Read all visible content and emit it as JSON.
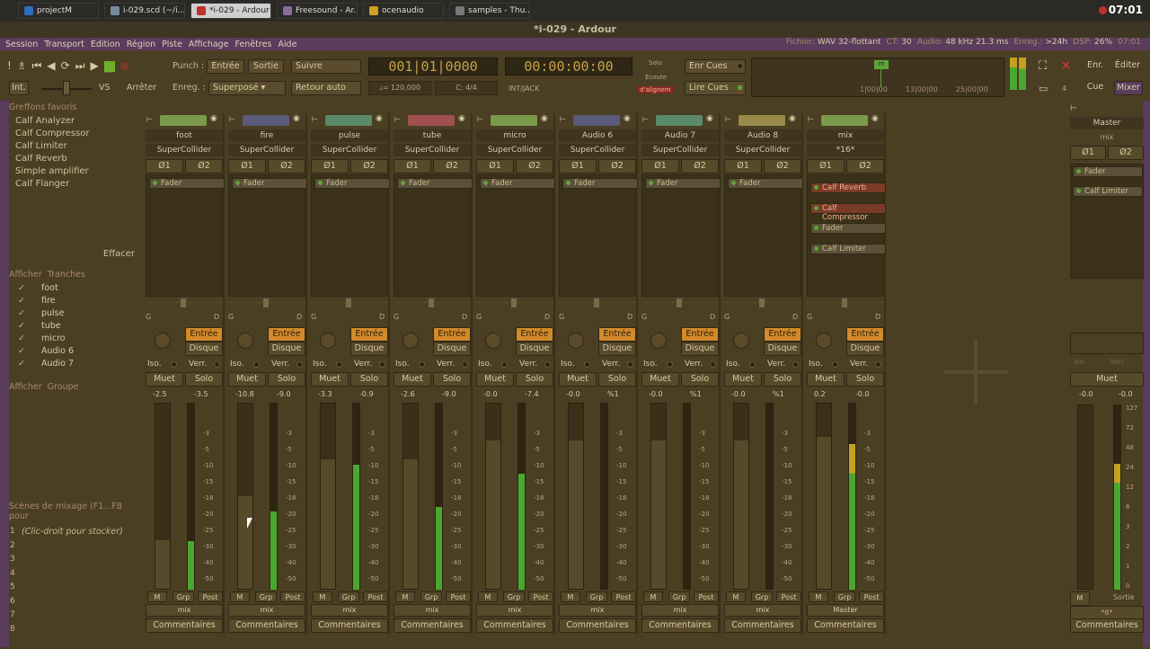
{
  "taskbar": {
    "items": [
      {
        "label": "projectM",
        "color": "#2b6fbf"
      },
      {
        "label": "i-029.scd (~/i...",
        "color": "#7a8aa0"
      },
      {
        "label": "*i-029 - Ardour",
        "color": "#c0302d"
      },
      {
        "label": "Freesound - Ar...",
        "color": "#8a6aa0"
      },
      {
        "label": "ocenaudio",
        "color": "#d0a020"
      },
      {
        "label": "samples - Thu...",
        "color": "#777777"
      }
    ],
    "clock": "07:01"
  },
  "window": {
    "title": "*i-029 - Ardour"
  },
  "menu": {
    "items": [
      "Session",
      "Transport",
      "Edition",
      "Région",
      "Piste",
      "Affichage",
      "Fenêtres",
      "Aide"
    ],
    "status": {
      "file_label": "Fichier:",
      "file_value": "WAV 32-flottant",
      "ct_label": "CT:",
      "ct_value": "30",
      "audio_label": "Audio:",
      "audio_value": "48 kHz 21.3 ms",
      "rec_label": "Enreg.:",
      "rec_value": ">24h",
      "dsp_label": "DSP:",
      "dsp_value": "26%",
      "time": "07:01"
    }
  },
  "toolbar": {
    "punch_label": "Punch :",
    "entree": "Entrée",
    "sortie": "Sortie",
    "suivre": "Suivre",
    "int": "Int.",
    "vs": "VS",
    "arreter": "Arrêter",
    "enreg_label": "Enreg. :",
    "superpose": "Superposé",
    "retour_auto": "Retour auto",
    "bbt": "001|01|0000",
    "timecode": "00:00:00:00",
    "tempo": "♩= 120,000",
    "meter": "C: 4/4",
    "sync": "INT/JACK",
    "solo": "Solo",
    "ecoute": "Écoute",
    "alignem": "d'alignem",
    "enr_cues": "Enr Cues",
    "lire_cues": "Lire Cues",
    "mini_timeline": {
      "marks": [
        "1|00|00",
        "13|00|00",
        "25|00|00"
      ],
      "flag": "m"
    },
    "right": {
      "enr": "Enr.",
      "editer": "Éditer",
      "cue": "Cue",
      "mixer": "Mixer",
      "four": "4"
    }
  },
  "left": {
    "favs_title": "Greffons favoris",
    "favs": [
      "Calf Analyzer",
      "Calf Compressor",
      "Calf Limiter",
      "Calf Reverb",
      "Simple amplifier",
      "Calf Flanger"
    ],
    "effacer": "Effacer",
    "show_label": "Afficher",
    "tranches_label": "Tranches",
    "tracks": [
      "foot",
      "fire",
      "pulse",
      "tube",
      "micro",
      "Audio 6",
      "Audio 7"
    ],
    "show_label2": "Afficher",
    "groupe_label": "Groupe",
    "scenes_title": "Scènes de mixage (F1...F8 pour",
    "scene_hint": "(Clic-droit pour stocker)",
    "scene_numbers": [
      "1",
      "2",
      "3",
      "4",
      "5",
      "6",
      "7",
      "8"
    ]
  },
  "strips": [
    {
      "name": "foot",
      "color": "#7a9a4a",
      "gain": "-2.5",
      "peak": "-3.5",
      "level": 0.26,
      "meter": 0.26
    },
    {
      "name": "fire",
      "color": "#5a5a7a",
      "gain": "-10.8",
      "peak": "-9.0",
      "level": 0.5,
      "meter": 0.42
    },
    {
      "name": "pulse",
      "color": "#5a8a6a",
      "gain": "-3.3",
      "peak": "-0.9",
      "level": 0.7,
      "meter": 0.67
    },
    {
      "name": "tube",
      "color": "#a05050",
      "gain": "-2.6",
      "peak": "-9.0",
      "level": 0.7,
      "meter": 0.44
    },
    {
      "name": "micro",
      "color": "#7a9a4a",
      "gain": "-0.0",
      "peak": "-7.4",
      "level": 0.8,
      "meter": 0.62
    },
    {
      "name": "Audio 6",
      "color": "#5a5a7a",
      "gain": "-0.0",
      "peak": "%1",
      "level": 0.8,
      "meter": 0.0
    },
    {
      "name": "Audio 7",
      "color": "#5a8a6a",
      "gain": "-0.0",
      "peak": "%1",
      "level": 0.8,
      "meter": 0.0
    },
    {
      "name": "Audio 8",
      "color": "#9a8a4a",
      "gain": "-0.0",
      "peak": "%1",
      "level": 0.8,
      "meter": 0.0
    },
    {
      "name": "mix",
      "color": "#7a9a4a",
      "gain": "0.2",
      "peak": "-0.0",
      "level": 0.82,
      "meter": 0.78
    }
  ],
  "strip_labels": {
    "input": "SuperCollider",
    "mix_input": "*16*",
    "phase1": "Ø1",
    "phase2": "Ø2",
    "fader_plugin": "Fader",
    "entree": "Entrée",
    "disque": "Disque",
    "iso": "Iso.",
    "verr": "Verr.",
    "muet": "Muet",
    "solo": "Solo",
    "m": "M",
    "grp": "Grp",
    "post": "Post",
    "comments": "Commentaires",
    "output": "mix",
    "mix_output": "Master"
  },
  "mix_plugins": [
    "Calf Reverb",
    "Calf Compressor",
    "Fader",
    "Calf Limiter"
  ],
  "scale_marks": [
    "-3",
    "-5",
    "-10",
    "-15",
    "-18",
    "-20",
    "-25",
    "-30",
    "-40",
    "-50"
  ],
  "master": {
    "title": "Master",
    "input": "mix",
    "phase1": "Ø1",
    "phase2": "Ø2",
    "plugins": [
      "Fader",
      "Calf Limiter"
    ],
    "iso": "Iso",
    "verr": "Verr.",
    "muet": "Muet",
    "gain": "-0.0",
    "peak": "-0.0",
    "scale": [
      "127",
      "72",
      "48",
      "24",
      "12",
      "6",
      "3",
      "2",
      "1",
      "0"
    ],
    "m": "M",
    "sortie": "Sortie",
    "mix_label": "*6*",
    "comments": "Commentaires",
    "meter": 0.68
  }
}
